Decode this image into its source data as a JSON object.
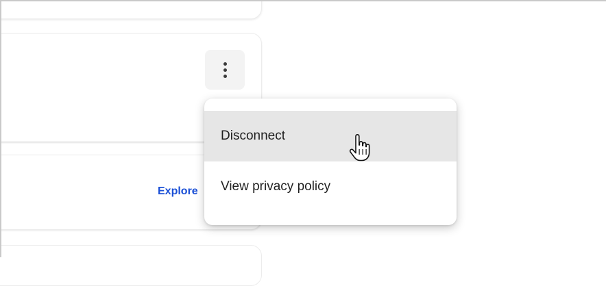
{
  "card_actions": {
    "kebab_icon": "more-vertical-icon",
    "explore_label": "Explore"
  },
  "menu": {
    "items": [
      {
        "label": "Disconnect",
        "state": "hover"
      },
      {
        "label": "View privacy policy",
        "state": "normal"
      }
    ]
  },
  "cursor": {
    "icon": "hand-pointer-icon"
  },
  "colors": {
    "link": "#1a4fd6",
    "hover_bg": "#e6e6e6",
    "button_bg": "#f3f3f3"
  }
}
